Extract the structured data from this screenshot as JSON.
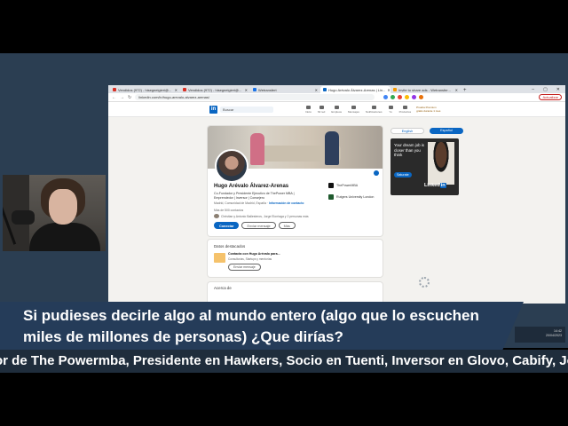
{
  "browser": {
    "tabs": [
      {
        "label": "Vendidos (972) - hisegneigieri@...",
        "active": false,
        "color": "#d93025"
      },
      {
        "label": "Vendidos (972) - hisegneigieri@...",
        "active": false,
        "color": "#d93025"
      },
      {
        "label": "Wetransfert",
        "active": false,
        "color": "#1a73e8"
      },
      {
        "label": "Hugo Arévalo Álvarez-Arenas | Lin...",
        "active": true,
        "color": "#0a66c2"
      },
      {
        "label": "Invite to share ads - Wetransfer...",
        "active": false,
        "color": "#f29900"
      }
    ],
    "new_tab": "+",
    "window_controls": [
      "–",
      "▢",
      "✕"
    ],
    "url": "linkedin.com/in/hugo-arevalo-alvarez-arenas/",
    "update_button": "Actualizar"
  },
  "linkedin": {
    "logo": "in",
    "search_placeholder": "Buscar",
    "nav_items": [
      "Inicio",
      "Mi red",
      "Empleos",
      "Mensajes",
      "Notificaciones",
      "Yo",
      "Productos"
    ],
    "premium_text": "Prueba Premium gratis durante 1 mes",
    "profile": {
      "name": "Hugo Arévalo Álvarez-Arenas",
      "headline": "Co-Fundador y Presidente Ejecutivo de ThePower MBA | Emprendedor | Inversor | Consejero",
      "location": "Madrid, Comunidad de Madrid, España",
      "contact_link": "Información de contacto",
      "connections": "Más de 500 contactos",
      "mutual": "Christian y Antonio Ballesteros, Jorge Elorriaga y 2 personas más",
      "connect_button": "Conectar",
      "message_button": "Enviar mensaje",
      "more_button": "Más",
      "orgs": [
        "ThePowerMBA",
        "Rutgers University London"
      ]
    },
    "featured": {
      "title": "Datos destacados",
      "item_title": "Contacta con Hugo Arévalo para...",
      "item_sub": "Consultorías, Startups y mentorías",
      "item_button": "Enviar mensaje"
    },
    "about": {
      "title": "Acerca de"
    },
    "language_buttons": {
      "english": "English",
      "spanish": "Español"
    },
    "ad": {
      "text": "Your dream job is closer than you think",
      "button": "Saturate",
      "logo": "Linked",
      "logo_in": "in"
    }
  },
  "taskbar": {
    "time": "14:42",
    "date": "20/04/2023"
  },
  "overlay": {
    "question": "Si pudieses decirle algo al mundo entero (algo que lo escuchen miles de millones de personas) ¿Que dirías?",
    "ticker": "or de The Powermba, Presidente en Hawkers, Socio en Tuenti, Inversor en Glovo, Cabify, Joba"
  }
}
